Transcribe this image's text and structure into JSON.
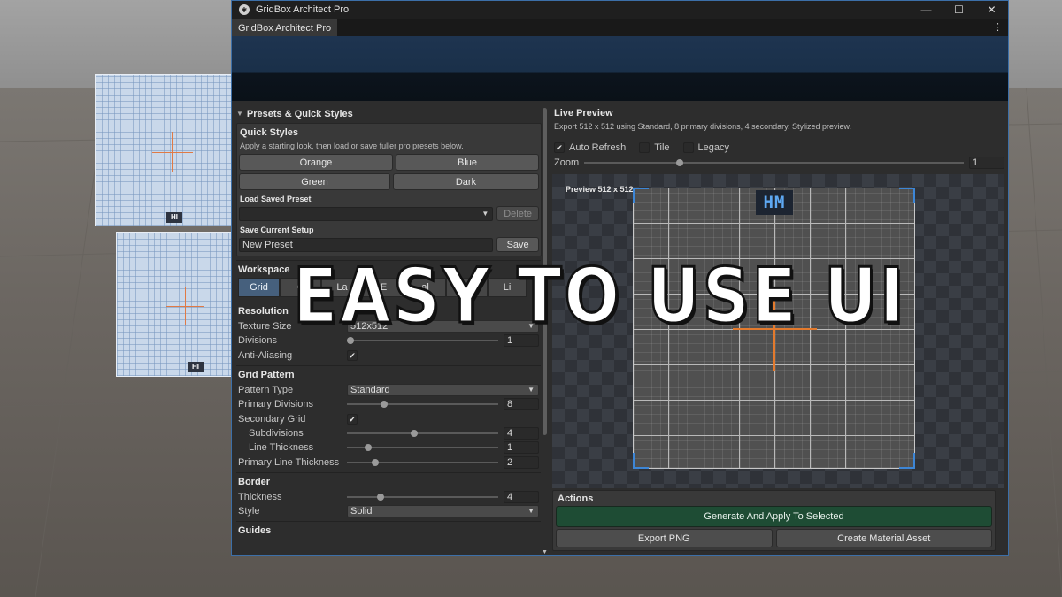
{
  "window": {
    "title": "GridBox Architect Pro",
    "tab_label": "GridBox Architect Pro",
    "minimize_glyph": "—",
    "maximize_glyph": "☐",
    "close_glyph": "✕",
    "kebab_glyph": "⋮"
  },
  "presets": {
    "foldout_label": "Presets & Quick Styles",
    "quick_styles_title": "Quick Styles",
    "quick_styles_hint": "Apply a starting look, then load or save fuller pro presets below.",
    "style_buttons": [
      "Orange",
      "Blue",
      "Green",
      "Dark"
    ],
    "load_label": "Load Saved Preset",
    "load_value": "",
    "delete_label": "Delete",
    "save_setup_label": "Save Current Setup",
    "preset_name": "New Preset",
    "save_label": "Save"
  },
  "workspace": {
    "title": "Workspace",
    "tabs": [
      "Grid",
      "C",
      "La",
      "E",
      "al",
      "Export",
      "Li"
    ]
  },
  "resolution": {
    "title": "Resolution",
    "texture_size_label": "Texture Size",
    "texture_size_value": "512x512",
    "divisions_label": "Divisions",
    "divisions_value": "1",
    "antialias_label": "Anti-Aliasing",
    "antialias_checked": true
  },
  "grid_pattern": {
    "title": "Grid Pattern",
    "pattern_type_label": "Pattern Type",
    "pattern_type_value": "Standard",
    "primary_divisions_label": "Primary Divisions",
    "primary_divisions_value": "8",
    "secondary_grid_label": "Secondary Grid",
    "secondary_grid_checked": true,
    "subdivisions_label": "Subdivisions",
    "subdivisions_value": "4",
    "line_thickness_label": "Line Thickness",
    "line_thickness_value": "1",
    "primary_line_thickness_label": "Primary Line Thickness",
    "primary_line_thickness_value": "2"
  },
  "border": {
    "title": "Border",
    "thickness_label": "Thickness",
    "thickness_value": "4",
    "style_label": "Style",
    "style_value": "Solid"
  },
  "guides": {
    "title": "Guides"
  },
  "live_preview": {
    "title": "Live Preview",
    "description": "Export 512 x 512 using Standard, 8 primary divisions, 4 secondary. Stylized preview.",
    "auto_refresh_label": "Auto Refresh",
    "auto_refresh_checked": true,
    "tile_label": "Tile",
    "tile_checked": false,
    "legacy_label": "Legacy",
    "legacy_checked": false,
    "zoom_label": "Zoom",
    "zoom_value": "1",
    "preview_label": "Preview 512 x 512",
    "badge_text": "HM"
  },
  "actions": {
    "title": "Actions",
    "generate_label": "Generate And Apply To Selected",
    "export_png_label": "Export PNG",
    "create_material_label": "Create Material Asset"
  },
  "scene": {
    "cube_badge_text": "HI"
  },
  "overlay": {
    "text": "EASY TO USE UI"
  },
  "colors": {
    "accent_blue": "#3d86d6",
    "active_tab": "#46607d",
    "generate_green": "#1e4c34",
    "crosshair_orange": "#e37a2d"
  }
}
